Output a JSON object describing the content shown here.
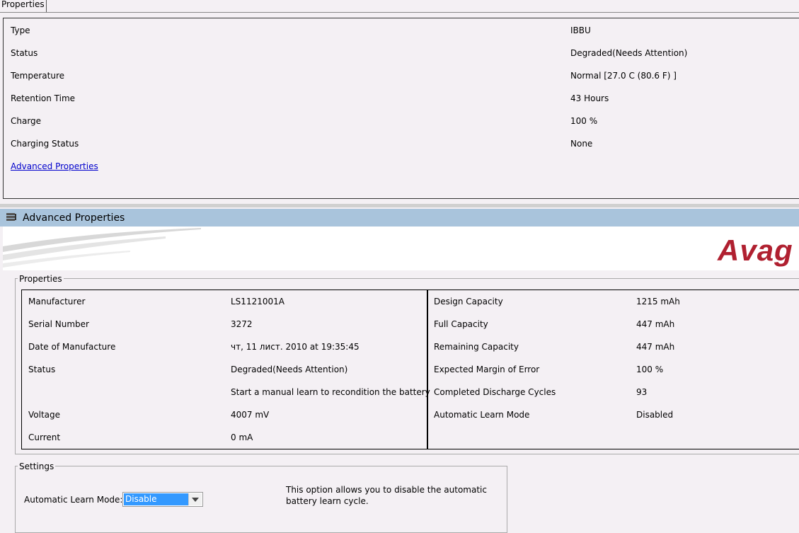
{
  "tab": {
    "label": "Properties"
  },
  "summary": {
    "rows": [
      {
        "label": "Type",
        "value": "IBBU"
      },
      {
        "label": "Status",
        "value": "Degraded(Needs Attention)"
      },
      {
        "label": "Temperature",
        "value": "Normal [27.0 C (80.6 F) ]"
      },
      {
        "label": "Retention Time",
        "value": "43 Hours"
      },
      {
        "label": "Charge",
        "value": "100 %"
      },
      {
        "label": "Charging Status",
        "value": "None"
      }
    ],
    "advanced_link": "Advanced Properties"
  },
  "advanced": {
    "header_title": "Advanced Properties",
    "logo_text": "Avag",
    "properties_title": "Properties",
    "left": [
      {
        "label": "Manufacturer",
        "value": "LS1121001A"
      },
      {
        "label": "Serial Number",
        "value": "3272"
      },
      {
        "label": "Date of Manufacture",
        "value": "чт, 11 лист. 2010 at 19:35:45"
      },
      {
        "label": "Status",
        "value": "Degraded(Needs Attention)"
      },
      {
        "label": "",
        "value": "Start a manual learn to recondition the battery"
      },
      {
        "label": "Voltage",
        "value": "4007 mV"
      },
      {
        "label": "Current",
        "value": "0 mA"
      }
    ],
    "right": [
      {
        "label": "Design Capacity",
        "value": "1215 mAh"
      },
      {
        "label": "Full Capacity",
        "value": "447 mAh"
      },
      {
        "label": "Remaining Capacity",
        "value": "447 mAh"
      },
      {
        "label": "Expected Margin of Error",
        "value": "100 %"
      },
      {
        "label": "Completed Discharge Cycles",
        "value": "93"
      },
      {
        "label": "Automatic Learn Mode",
        "value": "Disabled"
      }
    ]
  },
  "settings": {
    "title": "Settings",
    "learn_mode_label": "Automatic Learn Mode:",
    "learn_mode_value": "Disable",
    "description_line1": "This option allows you to disable the automatic",
    "description_line2": "battery learn cycle."
  },
  "colors": {
    "header_bg": "#a9c4dc",
    "link": "#0000cc",
    "logo": "#b02030",
    "select_highlight": "#3399ff"
  }
}
